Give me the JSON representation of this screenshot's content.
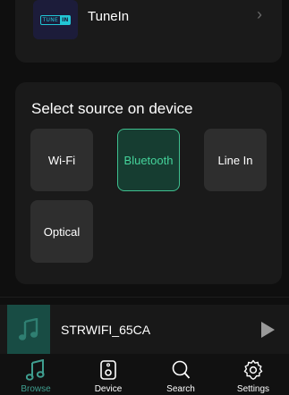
{
  "tunein": {
    "logo_text_left": "TUNE",
    "logo_text_right": "IN",
    "label": "TuneIn",
    "chevron": "›"
  },
  "source": {
    "title": "Select source on device",
    "buttons": [
      {
        "label": "Wi-Fi",
        "active": false
      },
      {
        "label": "Bluetooth",
        "active": true
      },
      {
        "label": "Line In",
        "active": false
      },
      {
        "label": "Optical",
        "active": false
      }
    ]
  },
  "now_playing": {
    "title": "STRWIFI_65CA",
    "art_icon": "music-note-icon",
    "play_icon": "play-icon"
  },
  "tabs": [
    {
      "label": "Browse",
      "icon": "music-note-icon",
      "active": true
    },
    {
      "label": "Device",
      "icon": "speaker-icon",
      "active": false
    },
    {
      "label": "Search",
      "icon": "search-icon",
      "active": false
    },
    {
      "label": "Settings",
      "icon": "gear-icon",
      "active": false
    }
  ],
  "colors": {
    "accent": "#3fbf8f",
    "active_tab": "#3f9e8f",
    "background": "#0f0f0f",
    "card": "#1a1a1a"
  }
}
